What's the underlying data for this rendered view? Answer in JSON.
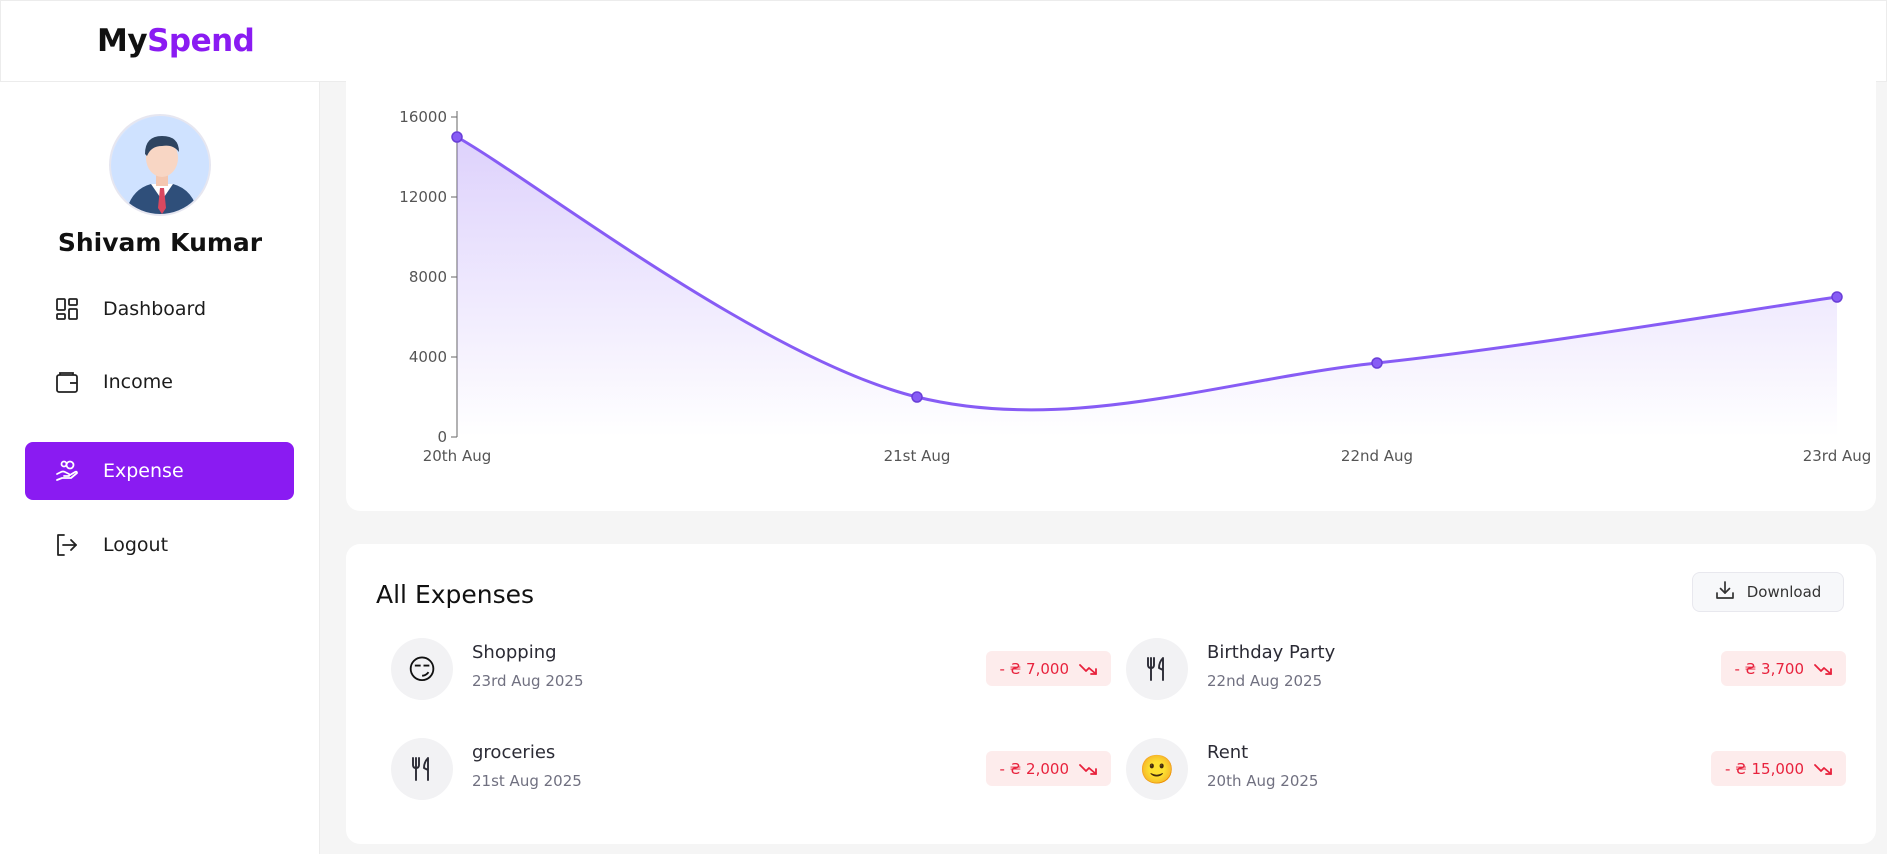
{
  "app": {
    "logo_my": "My",
    "logo_spend": "Spend"
  },
  "user": {
    "name": "Shivam Kumar"
  },
  "sidebar": {
    "items": [
      {
        "label": "Dashboard",
        "icon": "dashboard-icon",
        "active": false
      },
      {
        "label": "Income",
        "icon": "wallet-icon",
        "active": false
      },
      {
        "label": "Expense",
        "icon": "hand-coins-icon",
        "active": true
      },
      {
        "label": "Logout",
        "icon": "logout-icon",
        "active": false
      }
    ]
  },
  "colors": {
    "accent": "#8a1bf2",
    "line": "#875cf5",
    "negative": "#e8223d",
    "negative_bg": "#fdecec"
  },
  "chart_data": {
    "type": "area",
    "categories": [
      "20th Aug",
      "21st Aug",
      "22nd Aug",
      "23rd Aug"
    ],
    "values": [
      15000,
      2000,
      3700,
      7000
    ],
    "yticks": [
      0,
      4000,
      8000,
      12000,
      16000
    ],
    "ylim": [
      0,
      16000
    ],
    "grid": false
  },
  "expenses": {
    "title": "All Expenses",
    "download_label": "Download",
    "items": [
      {
        "name": "Shopping",
        "date": "23rd Aug 2025",
        "amount": "- ₴ 7,000",
        "icon": "😏"
      },
      {
        "name": "Birthday Party",
        "date": "22nd Aug 2025",
        "amount": "- ₴ 3,700",
        "icon": "utensils-icon"
      },
      {
        "name": "groceries",
        "date": "21st Aug 2025",
        "amount": "- ₴ 2,000",
        "icon": "utensils-icon"
      },
      {
        "name": "Rent",
        "date": "20th Aug 2025",
        "amount": "- ₴ 15,000",
        "icon": "🙂"
      }
    ]
  }
}
